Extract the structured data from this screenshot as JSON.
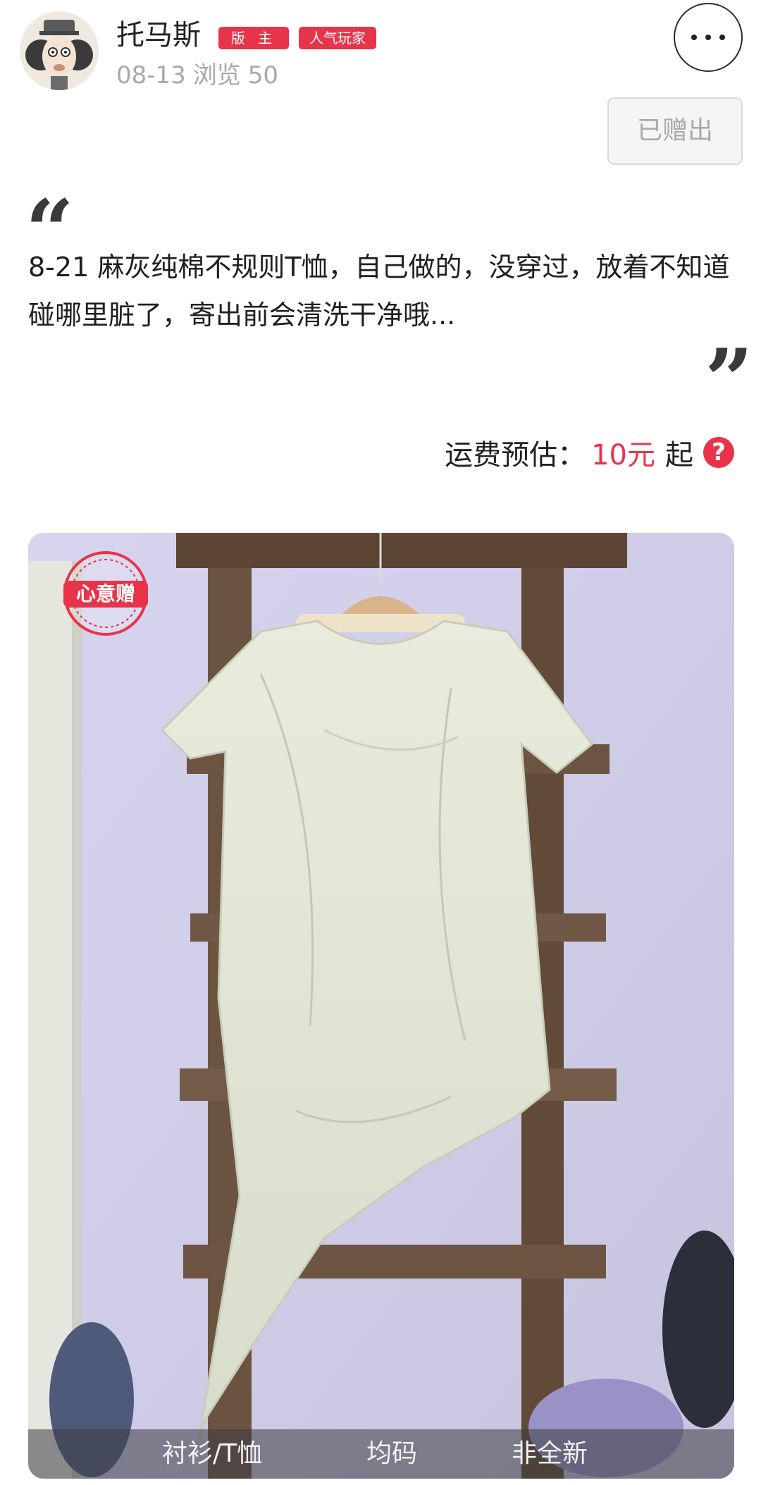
{
  "user": {
    "name": "托马斯",
    "badges": [
      "版 主",
      "人气玩家"
    ],
    "date": "08-13",
    "views_label": "浏览",
    "views": "50"
  },
  "actions": {
    "given_label": "已赠出"
  },
  "post": {
    "description": "8-21 麻灰纯棉不规则T恤，自己做的，没穿过，放着不知道碰哪里脏了，寄出前会清洗干净哦..."
  },
  "shipping": {
    "label": "运费预估：",
    "price": "10元",
    "suffix": "起",
    "help": "?"
  },
  "photo": {
    "stamp_label": "心意赠",
    "tags": [
      "衬衫/T恤",
      "均码",
      "非全新"
    ]
  },
  "icons": {
    "more": "more-icon",
    "help": "question-icon",
    "quote_open": "quote-open-icon",
    "quote_close": "quote-close-icon"
  },
  "colors": {
    "accent": "#e8344a",
    "muted_text": "#a8a8a8"
  }
}
